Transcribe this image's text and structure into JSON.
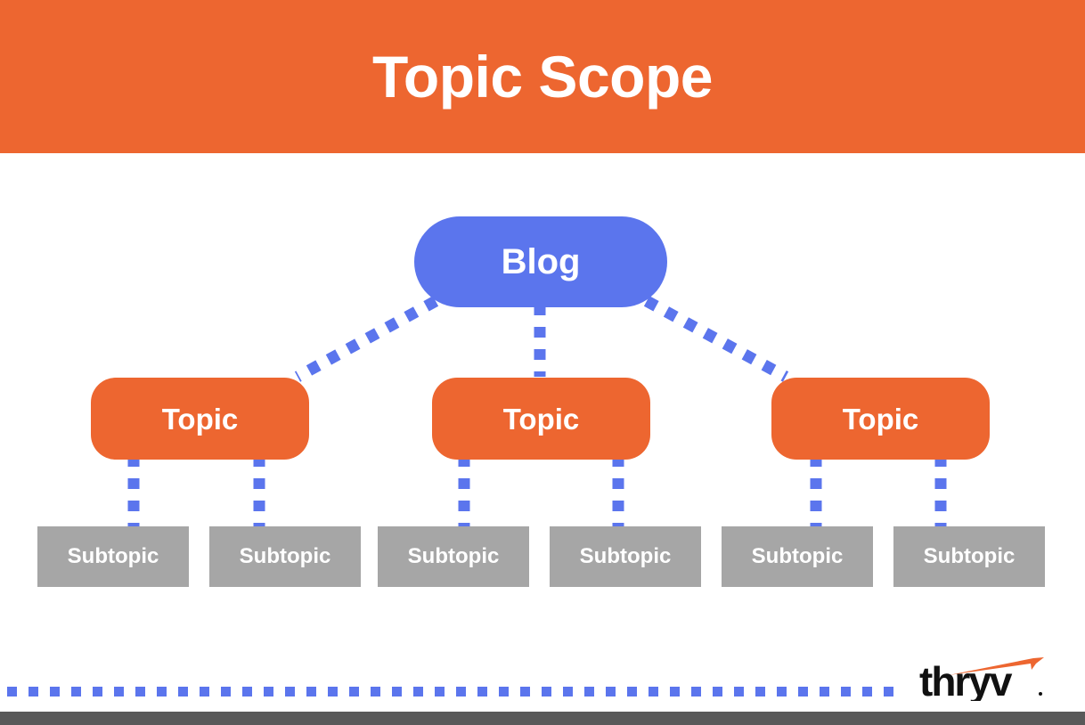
{
  "header": {
    "title": "Topic Scope",
    "background_color": "#ED6630",
    "text_color": "#FFFFFF"
  },
  "diagram": {
    "type": "hierarchy-tree",
    "root": {
      "label": "Blog",
      "shape": "pill",
      "color": "#5B75ED"
    },
    "topics": [
      {
        "label": "Topic",
        "shape": "rounded-rect",
        "color": "#ED6630"
      },
      {
        "label": "Topic",
        "shape": "rounded-rect",
        "color": "#ED6630"
      },
      {
        "label": "Topic",
        "shape": "rounded-rect",
        "color": "#ED6630"
      }
    ],
    "subtopics": [
      {
        "label": "Subtopic",
        "shape": "rect",
        "color": "#A6A6A6"
      },
      {
        "label": "Subtopic",
        "shape": "rect",
        "color": "#A6A6A6"
      },
      {
        "label": "Subtopic",
        "shape": "rect",
        "color": "#A6A6A6"
      },
      {
        "label": "Subtopic",
        "shape": "rect",
        "color": "#A6A6A6"
      },
      {
        "label": "Subtopic",
        "shape": "rect",
        "color": "#A6A6A6"
      },
      {
        "label": "Subtopic",
        "shape": "rect",
        "color": "#A6A6A6"
      }
    ],
    "connector_color": "#5B75ED",
    "connector_style": "dotted"
  },
  "footer": {
    "logo_text": "thryv",
    "logo_text_color": "#111111",
    "logo_swoosh_color": "#ED6630",
    "divider_color": "#5B75ED",
    "bar_color": "#595959"
  }
}
